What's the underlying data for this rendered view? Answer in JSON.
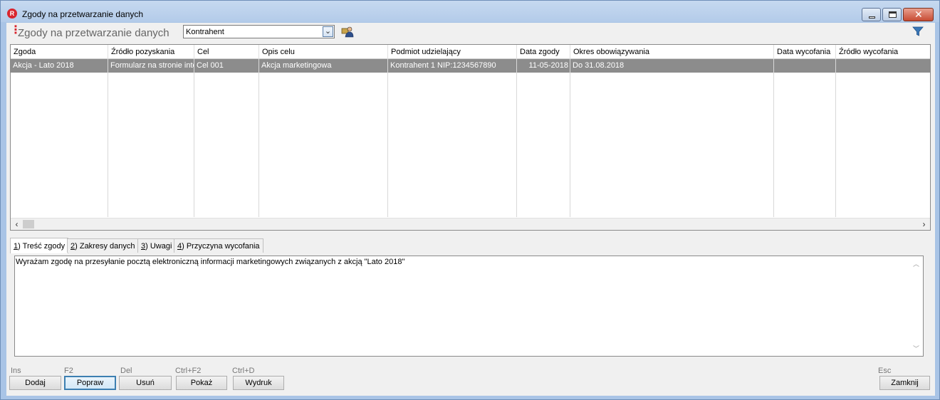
{
  "window": {
    "icon_letter": "R",
    "title": "Zgody na przetwarzanie danych"
  },
  "header": {
    "title": "Zgody na przetwarzanie danych",
    "combo_value": "Kontrahent"
  },
  "grid": {
    "columns": [
      "Zgoda",
      "Źródło pozyskania",
      "Cel",
      "Opis celu",
      "Podmiot udzielający",
      "Data zgody",
      "Okres obowiązywania",
      "Data wycofania",
      "Źródło wycofania"
    ],
    "rows": [
      {
        "zgoda": "Akcja - Lato 2018",
        "zrodlo": "Formularz na stronie internetowej",
        "cel": "Cel 001",
        "opis": "Akcja marketingowa",
        "podmiot": "Kontrahent 1 NIP:1234567890",
        "data_zgody": "11-05-2018",
        "okres": "Do 31.08.2018",
        "data_wycofania": "",
        "zrodlo_wycofania": ""
      }
    ]
  },
  "tabs": [
    {
      "key": "1",
      "label": ") Treść zgody"
    },
    {
      "key": "2",
      "label": ") Zakresy danych"
    },
    {
      "key": "3",
      "label": ") Uwagi"
    },
    {
      "key": "4",
      "label": ") Przyczyna wycofania"
    }
  ],
  "memo": {
    "text": "Wyrażam zgodę na przesyłanie pocztą elektroniczną informacji marketingowych związanych z akcją \"Lato 2018\""
  },
  "buttons": [
    {
      "hotkey": "Ins",
      "label": "Dodaj"
    },
    {
      "hotkey": "F2",
      "label": "Popraw"
    },
    {
      "hotkey": "Del",
      "label": "Usuń"
    },
    {
      "hotkey": "Ctrl+F2",
      "label": "Pokaż"
    },
    {
      "hotkey": "Ctrl+D",
      "label": "Wydruk"
    },
    {
      "hotkey": "Esc",
      "label": "Zamknij"
    }
  ],
  "colors": {
    "brand_red": "#d9252e",
    "selected_row": "#8c8c8c",
    "filter_blue": "#3a78b8"
  }
}
